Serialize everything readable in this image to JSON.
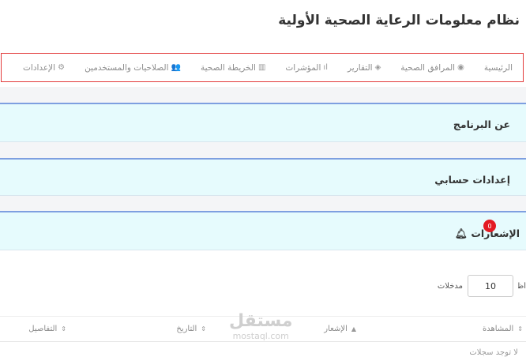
{
  "header": {
    "title": "نظام معلومات الرعاية الصحية الأولية"
  },
  "nav": {
    "items": [
      {
        "label": "الرئيسية",
        "icon": "home-icon",
        "glyph": ""
      },
      {
        "label": "المرافق الصحية",
        "icon": "globe-icon",
        "glyph": "◉"
      },
      {
        "label": "التقارير",
        "icon": "reports-icon",
        "glyph": "◈"
      },
      {
        "label": "المؤشرات",
        "icon": "bar-chart-icon",
        "glyph": "ıl"
      },
      {
        "label": "الخريطة الصحية",
        "icon": "map-icon",
        "glyph": "▥"
      },
      {
        "label": "الصلاحيات والمستخدمين",
        "icon": "users-icon",
        "glyph": "👥"
      },
      {
        "label": "الإعدادات",
        "icon": "gear-icon",
        "glyph": "⚙"
      }
    ]
  },
  "sections": [
    {
      "label": "عن البرنامج"
    },
    {
      "label": "إعدادات حسابي"
    },
    {
      "label": "الإشعارات",
      "badge": "0",
      "icon": "bell-icon"
    }
  ],
  "table_controls": {
    "show_label": "أظهر",
    "count_value": "10",
    "entries_label": "مدخلات"
  },
  "table": {
    "headers": [
      {
        "label": "المشاهدة",
        "sort": "⇕"
      },
      {
        "label": "الإشعار",
        "sort": "▲"
      },
      {
        "label": "التاريخ",
        "sort": "⇕"
      },
      {
        "label": "التفاصيل",
        "sort": "⇕"
      }
    ],
    "first_row_peek": "لا توجد سجلات"
  },
  "watermark": {
    "line1": "مستقل",
    "line2": "mostaql.com"
  },
  "colors": {
    "nav_border": "#e23a3a",
    "section_bg": "#e6fbfd",
    "section_border": "#7e9fe0",
    "badge": "#e31b23"
  }
}
